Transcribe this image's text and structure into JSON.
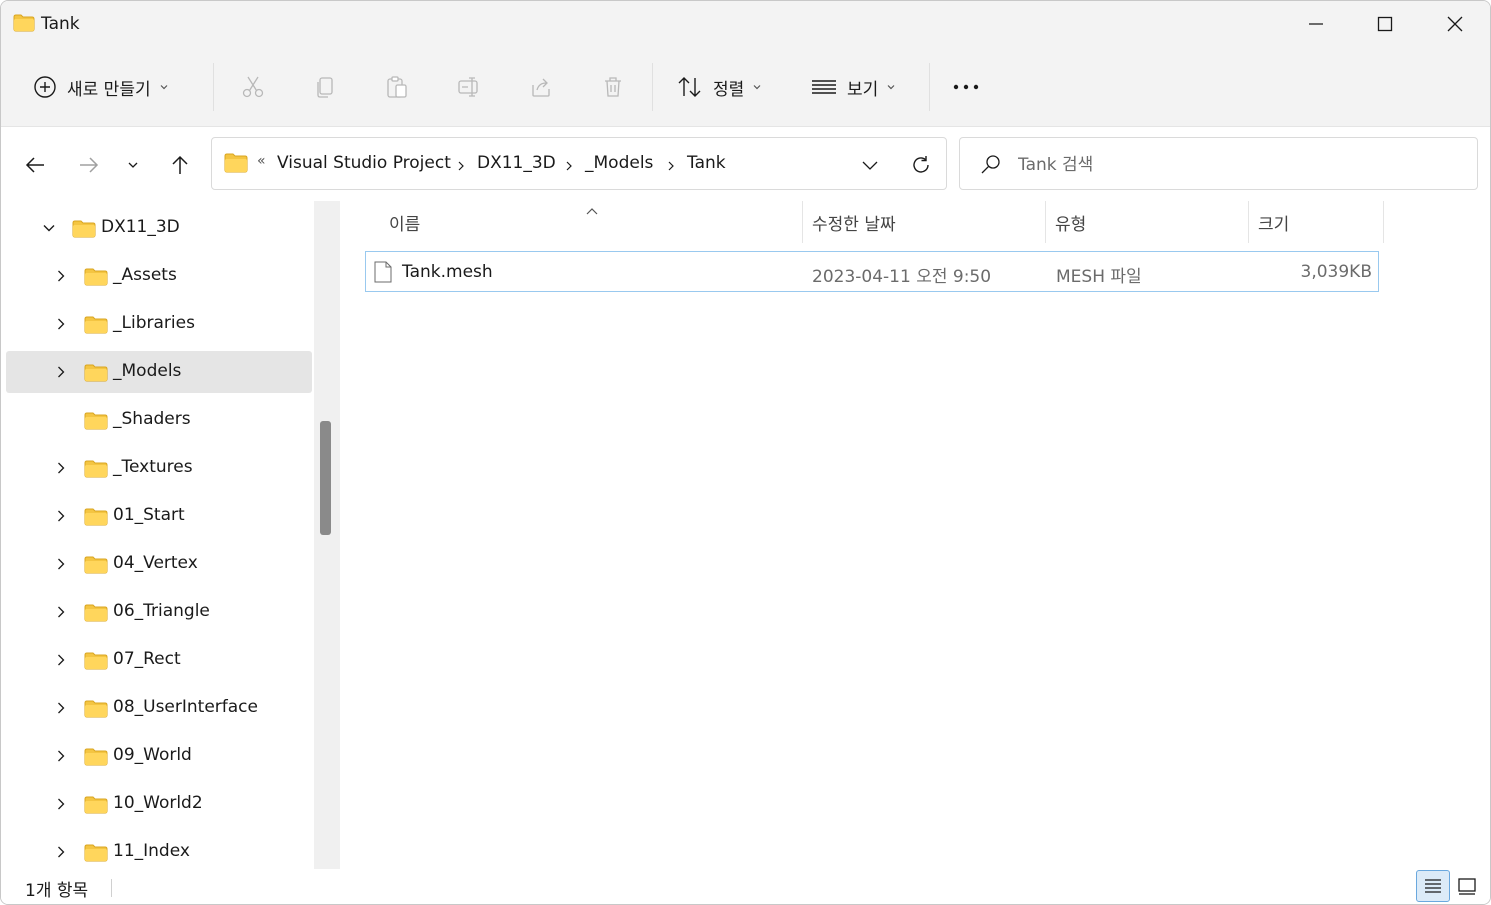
{
  "window": {
    "title": "Tank"
  },
  "toolbar": {
    "new_label": "새로 만들기",
    "sort_label": "정렬",
    "view_label": "보기",
    "more_label": "•••"
  },
  "address": {
    "overflow_label": "«",
    "crumbs": [
      "Visual Studio Project",
      "DX11_3D",
      "_Models",
      "Tank"
    ]
  },
  "search": {
    "placeholder": "Tank 검색",
    "value": ""
  },
  "nav": {
    "items": [
      {
        "label": "DX11_3D",
        "expanded": true,
        "has_children": true,
        "selected": false,
        "level": 0
      },
      {
        "label": "_Assets",
        "expanded": false,
        "has_children": true,
        "selected": false,
        "level": 1
      },
      {
        "label": "_Libraries",
        "expanded": false,
        "has_children": true,
        "selected": false,
        "level": 1
      },
      {
        "label": "_Models",
        "expanded": false,
        "has_children": true,
        "selected": true,
        "level": 1
      },
      {
        "label": "_Shaders",
        "expanded": false,
        "has_children": false,
        "selected": false,
        "level": 1
      },
      {
        "label": "_Textures",
        "expanded": false,
        "has_children": true,
        "selected": false,
        "level": 1
      },
      {
        "label": "01_Start",
        "expanded": false,
        "has_children": true,
        "selected": false,
        "level": 1
      },
      {
        "label": "04_Vertex",
        "expanded": false,
        "has_children": true,
        "selected": false,
        "level": 1
      },
      {
        "label": "06_Triangle",
        "expanded": false,
        "has_children": true,
        "selected": false,
        "level": 1
      },
      {
        "label": "07_Rect",
        "expanded": false,
        "has_children": true,
        "selected": false,
        "level": 1
      },
      {
        "label": "08_UserInterface",
        "expanded": false,
        "has_children": true,
        "selected": false,
        "level": 1
      },
      {
        "label": "09_World",
        "expanded": false,
        "has_children": true,
        "selected": false,
        "level": 1
      },
      {
        "label": "10_World2",
        "expanded": false,
        "has_children": true,
        "selected": false,
        "level": 1
      },
      {
        "label": "11_Index",
        "expanded": false,
        "has_children": true,
        "selected": false,
        "level": 1
      }
    ]
  },
  "filelist": {
    "columns": {
      "name": "이름",
      "date": "수정한 날짜",
      "type": "유형",
      "size": "크기"
    },
    "files": [
      {
        "name": "Tank.mesh",
        "date": "2023-04-11 오전 9:50",
        "type": "MESH 파일",
        "size": "3,039KB"
      }
    ]
  },
  "status": {
    "count_text": "1개 항목"
  },
  "colors": {
    "folder": "#f4c542",
    "selection_border": "#99c9ef",
    "accent": "#0067c0"
  }
}
